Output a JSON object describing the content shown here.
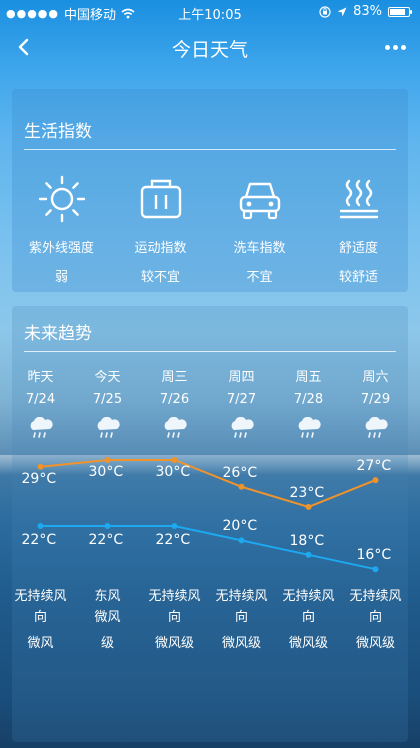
{
  "status_bar": {
    "carrier": "中国移动",
    "time": "上午10:05",
    "battery": "83%",
    "battery_level": 0.83
  },
  "nav": {
    "title": "今日天气"
  },
  "life_index": {
    "title": "生活指数",
    "items": [
      {
        "icon": "sun-icon",
        "name": "紫外线强度",
        "value": "弱"
      },
      {
        "icon": "exercise-icon",
        "name": "运动指数",
        "value": "较不宜"
      },
      {
        "icon": "car-wash-icon",
        "name": "洗车指数",
        "value": "不宜"
      },
      {
        "icon": "comfort-icon",
        "name": "舒适度",
        "value": "较舒适"
      }
    ]
  },
  "trend": {
    "title": "未来趋势",
    "days": [
      {
        "name": "昨天",
        "date": "7/24",
        "high": 29,
        "low": 22,
        "high_label": "29°C",
        "low_label": "22°C",
        "wind_dir": "无持续风向",
        "wind_dir_lines": [
          "无持续风",
          "向"
        ],
        "wind_level": "微风"
      },
      {
        "name": "今天",
        "date": "7/25",
        "high": 30,
        "low": 22,
        "high_label": "30°C",
        "low_label": "22°C",
        "wind_dir": "东风",
        "wind_dir_lines": [
          "东风",
          "微风"
        ],
        "wind_level": "级"
      },
      {
        "name": "周三",
        "date": "7/26",
        "high": 30,
        "low": 22,
        "high_label": "30°C",
        "low_label": "22°C",
        "wind_dir": "无持续风向",
        "wind_dir_lines": [
          "无持续风",
          "向"
        ],
        "wind_level": "微风级"
      },
      {
        "name": "周四",
        "date": "7/27",
        "high": 26,
        "low": 20,
        "high_label": "26°C",
        "low_label": "20°C",
        "wind_dir": "无持续风向",
        "wind_dir_lines": [
          "无持续风",
          "向"
        ],
        "wind_level": "微风级"
      },
      {
        "name": "周五",
        "date": "7/28",
        "high": 23,
        "low": 18,
        "high_label": "23°C",
        "low_label": "18°C",
        "wind_dir": "无持续风向",
        "wind_dir_lines": [
          "无持续风",
          "向"
        ],
        "wind_level": "微风级"
      },
      {
        "name": "周六",
        "date": "7/29",
        "high": 27,
        "low": 16,
        "high_label": "27°C",
        "low_label": "16°C",
        "wind_dir": "无持续风向",
        "wind_dir_lines": [
          "无持续风",
          "向"
        ],
        "wind_level": "微风级"
      }
    ],
    "high_color": "#f0932b",
    "low_color": "#1ea8f0",
    "icon": "rain-cloud-icon"
  }
}
